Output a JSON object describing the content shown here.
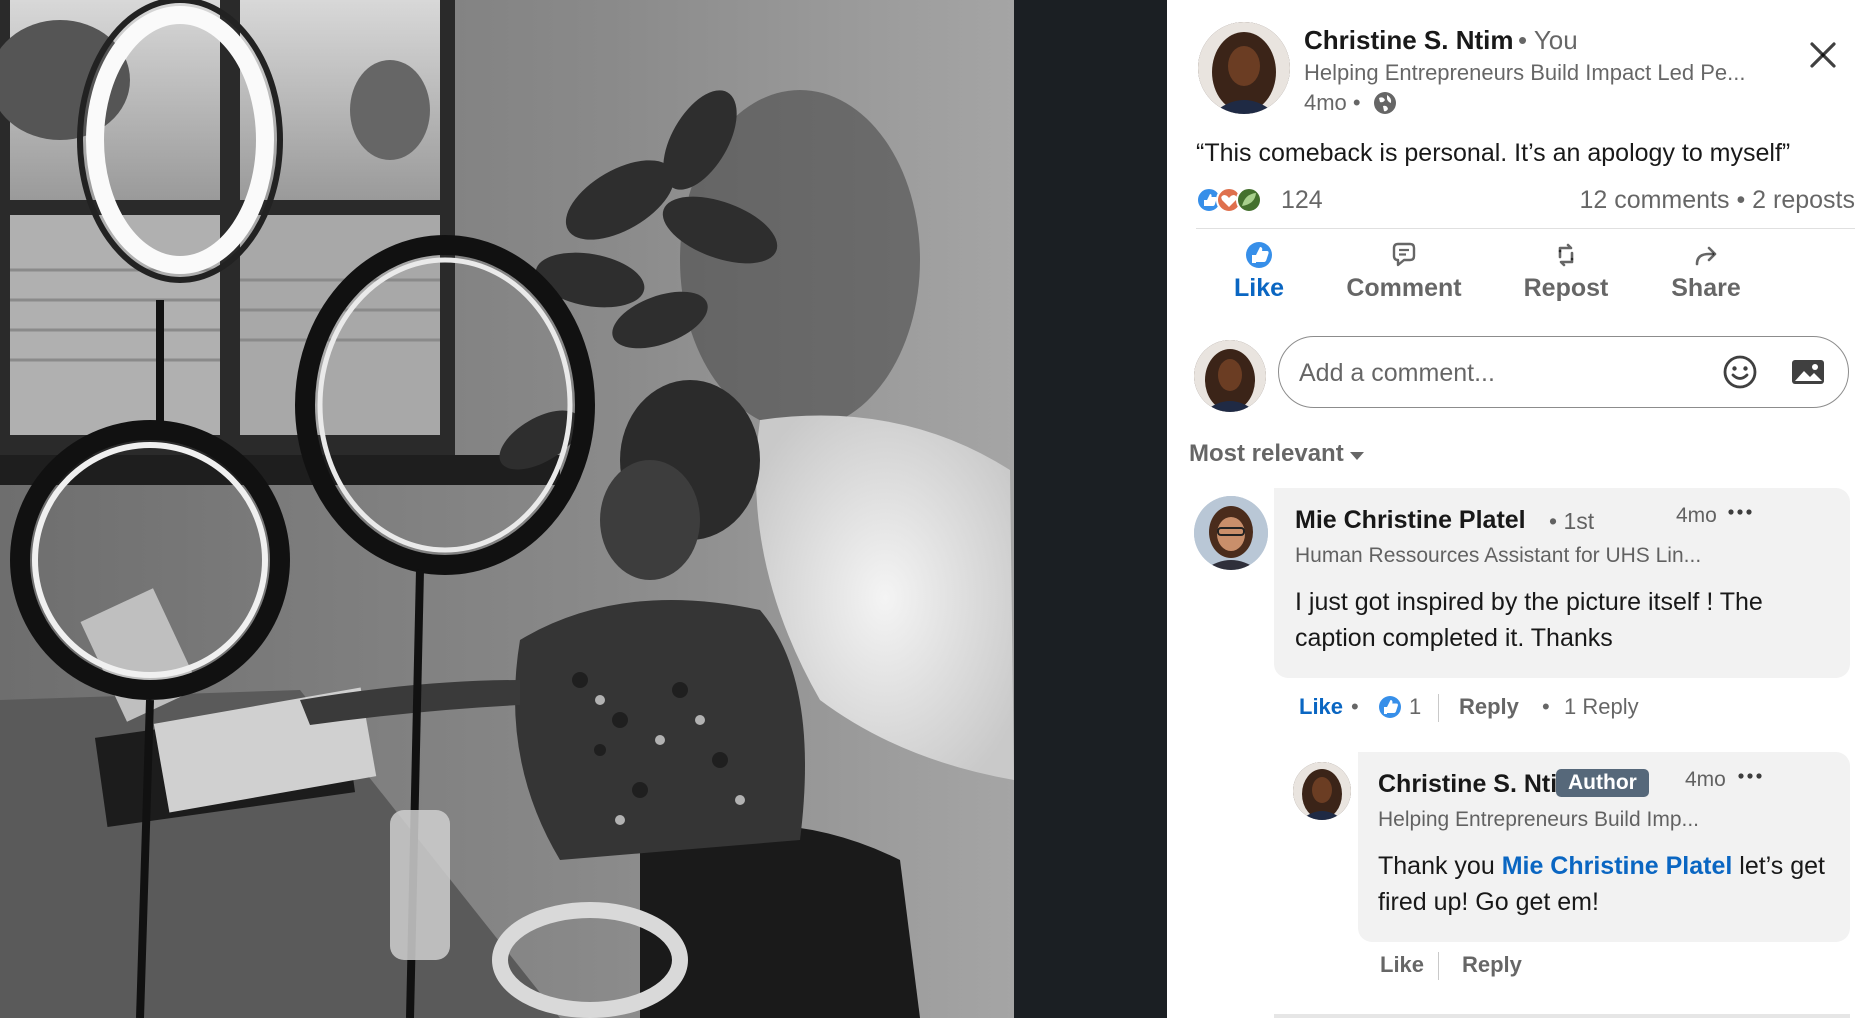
{
  "post": {
    "author_name": "Christine S. Ntim",
    "author_relation": "• You",
    "author_headline": "Helping Entrepreneurs Build Impact Led Pe...",
    "time": "4mo •",
    "visibility_icon": "globe-icon",
    "text": "“This comeback is personal. It’s an apology to myself”",
    "reaction_count": "124",
    "comments_label": "12 comments",
    "separator": " • ",
    "reposts_label": "2 reposts"
  },
  "actions": {
    "like": "Like",
    "comment": "Comment",
    "repost": "Repost",
    "share": "Share"
  },
  "comment_input": {
    "placeholder": "Add a comment..."
  },
  "sort": {
    "label": "Most relevant"
  },
  "comments": [
    {
      "name": "Mie Christine Platel",
      "degree": "• 1st",
      "time": "4mo",
      "headline": "Human Ressources Assistant for UHS Lin...",
      "text": "I just got inspired by the picture itself ! The caption completed it. Thanks",
      "like_label": "Like",
      "dot": "•",
      "like_count": "1",
      "reply_label": "Reply",
      "replies_label": "1 Reply"
    }
  ],
  "reply": {
    "name": "Christine S. Ntim",
    "badge": "Author",
    "time": "4mo",
    "headline": "Helping Entrepreneurs Build Imp...",
    "text_before": "Thank you ",
    "mention": "Mie Christine Platel",
    "text_after": " let’s get fired up! Go get em!",
    "like_label": "Like",
    "reply_label": "Reply"
  },
  "colors": {
    "accent": "#0a66c2",
    "badge": "#56687a",
    "bubble": "#f2f2f2",
    "dark_strip": "#1b1f23"
  }
}
